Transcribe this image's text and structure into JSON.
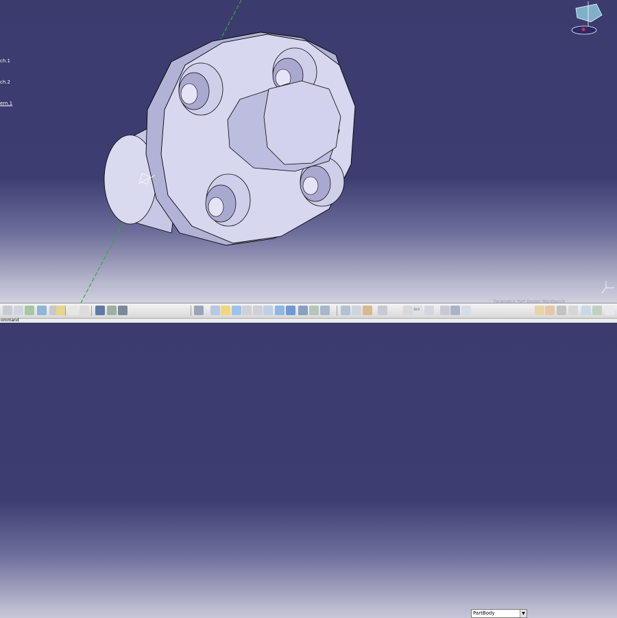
{
  "spec_tree": [
    {
      "label": "ch.1"
    },
    {
      "label": "ch.2"
    },
    {
      "label": "ern.1",
      "selected": true
    }
  ],
  "toolbar": {
    "body_select_value": "PartBody",
    "zoom_ratio": "10.0",
    "zoom_ratio_top": "10.0"
  },
  "status": {
    "command_label": "ommand"
  },
  "faint_texts": [
    "Parametric Part Design Workbench"
  ],
  "colors": {
    "background_top": "#3b3b6e",
    "background_bottom": "#d4d4e2",
    "part_fill": "#d7d7ef",
    "part_shade": "#a9a9cf",
    "axis_green": "#2fae2f"
  },
  "icons": [
    "cut-icon",
    "copy-icon",
    "paste-icon",
    "undo-icon",
    "redo-icon",
    "whats-this-icon",
    "formula-icon",
    "comment-icon",
    "table-icon",
    "catalog-icon",
    "save-icon",
    "fly-mode-icon",
    "fit-all-icon",
    "pan-icon",
    "rotate-icon",
    "zoom-in-icon",
    "zoom-out-icon",
    "normal-view-icon",
    "multi-view-icon",
    "iso-view-icon",
    "shading-icon",
    "hide-show-icon",
    "swap-icon",
    "measure-icon"
  ]
}
